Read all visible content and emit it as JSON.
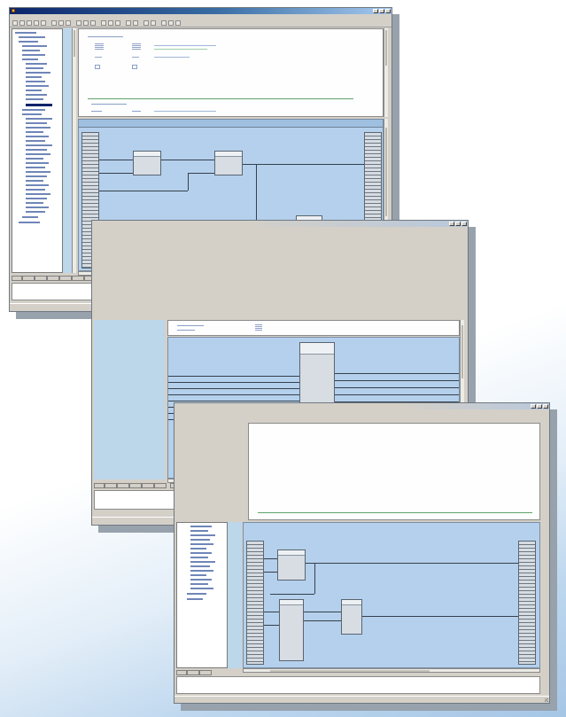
{
  "colors": {
    "title_bar": "#0a246a",
    "window_chrome": "#d4d0c8",
    "diagram_background": "#b4d0ec",
    "block_fill": "#d7dde3",
    "wire": "#36404c"
  },
  "icons": [
    "app-icon",
    "minimize-icon",
    "maximize-icon",
    "close-icon",
    "toolbar-button-icon"
  ],
  "window_top": {
    "title": "",
    "menus": [
      "",
      "",
      "",
      "",
      "",
      ""
    ],
    "status": "",
    "output_line": ""
  },
  "window_middle": {
    "status": "",
    "output_line": ""
  },
  "window_bottom": {
    "status": "",
    "output_line": ""
  }
}
